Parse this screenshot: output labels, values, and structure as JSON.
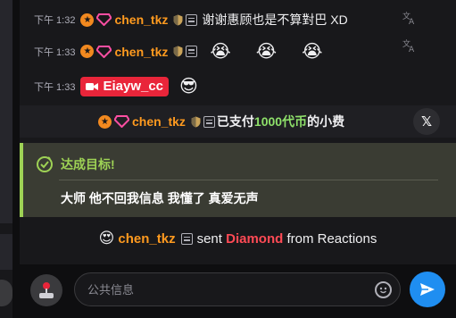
{
  "messages": [
    {
      "time": "下午 1:32",
      "username": "chen_tkz",
      "text": "谢谢惠顾也是不算對巴 XD"
    },
    {
      "time": "下午 1:33",
      "username": "chen_tkz",
      "emojis": [
        "😭",
        "😭",
        "😭"
      ]
    },
    {
      "time": "下午 1:33",
      "username": "Eiayw_cc",
      "emoji": "😎"
    }
  ],
  "tip": {
    "username": "chen_tkz",
    "prefix": "已支付",
    "amount": "1000代币",
    "suffix": "的小费"
  },
  "goal": {
    "title": "达成目标!",
    "text": "大师 他不回我信息 我懂了 真爱无声"
  },
  "diamond": {
    "emoji": "😍",
    "username": "chen_tkz",
    "sent": "sent",
    "item": "Diamond",
    "source": "from Reactions"
  },
  "input": {
    "placeholder": "公共信息"
  },
  "colors": {
    "accent_green": "#9ed255",
    "send_blue": "#1f8ef1",
    "cam_red": "#e9253a",
    "username_orange": "#ff9a1f"
  },
  "icons": {
    "translate": "translate-icon",
    "x_logo": "x-logo-icon",
    "goal": "target-check-icon",
    "joystick": "joystick-icon",
    "emoji": "smiley-icon",
    "send": "send-icon"
  }
}
